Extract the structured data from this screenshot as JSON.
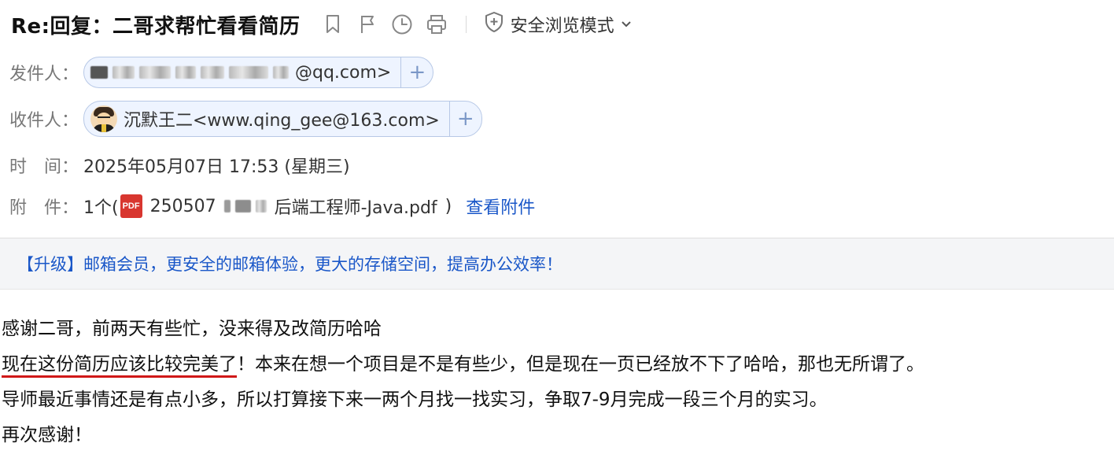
{
  "header": {
    "subject": "Re:回复：二哥求帮忙看看简历",
    "safe_mode_label": "安全浏览模式"
  },
  "meta": {
    "from_label": "发件人：",
    "from_email_suffix": "@qq.com>",
    "to_label": "收件人：",
    "to_display": "沉默王二<www.qing_gee@163.com>",
    "time_label": "时　间：",
    "time_value": "2025年05月07日 17:53 (星期三)",
    "attach_label": "附　件：",
    "attach_count": "1个(",
    "attach_prefix": "250507",
    "attach_name_suffix": "后端工程师-Java.pdf",
    "attach_close": ")",
    "view_attachments": "查看附件",
    "pdf_badge": "PDF",
    "add_symbol": "+"
  },
  "banner": {
    "text": "【升级】邮箱会员，更安全的邮箱体验，更大的存储空间，提高办公效率！"
  },
  "body": {
    "line1": "感谢二哥，前两天有些忙，没来得及改简历哈哈",
    "line2_underlined": "现在这份简历应该比较完美了",
    "line2_rest": "！本来在想一个项目是不是有些少，但是现在一页已经放不下了哈哈，那也无所谓了。",
    "line3": "导师最近事情还是有点小多，所以打算接下来一两个月找一找实习，争取7-9月完成一段三个月的实习。",
    "line4": "再次感谢！"
  },
  "icons": {
    "bookmark": "bookmark-icon",
    "flag": "flag-icon",
    "clock": "clock-icon",
    "print": "print-icon",
    "shield": "shield-icon",
    "chevron": "chevron-down-icon",
    "pdf": "pdf-icon"
  },
  "colors": {
    "link": "#1a57c8",
    "underline": "#d01818",
    "pill_bg": "#eef4ff",
    "pill_border": "#b7c8e6",
    "banner_bg": "#f4f5f7"
  }
}
